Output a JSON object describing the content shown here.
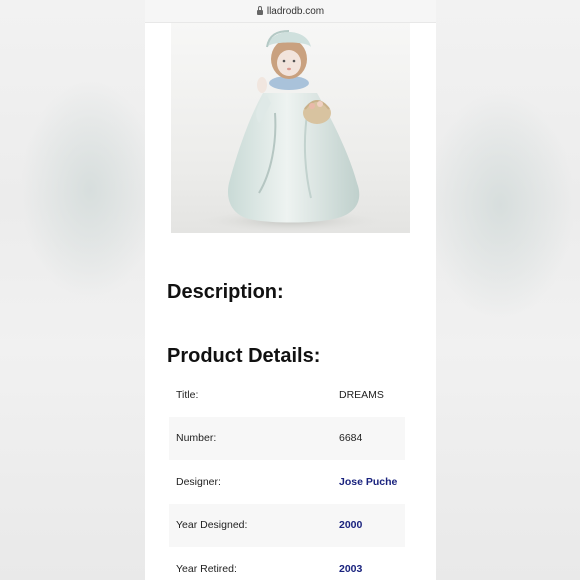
{
  "browser": {
    "url": "lladrodb.com",
    "lock_icon": "lock-icon"
  },
  "product": {
    "image_icon": "porcelain-figurine-girl-with-basket"
  },
  "sections": {
    "description_heading": "Description:",
    "product_details_heading": "Product Details:"
  },
  "details": [
    {
      "label": "Title:",
      "value": "DREAMS",
      "link": false
    },
    {
      "label": "Number:",
      "value": "6684",
      "link": false
    },
    {
      "label": "Designer:",
      "value": "Jose Puche",
      "link": true
    },
    {
      "label": "Year Designed:",
      "value": "2000",
      "link": true
    },
    {
      "label": "Year Retired:",
      "value": "2003",
      "link": true
    }
  ],
  "colors": {
    "link": "#1a237e",
    "row_shade": "#f7f7f7",
    "heading": "#111111"
  }
}
